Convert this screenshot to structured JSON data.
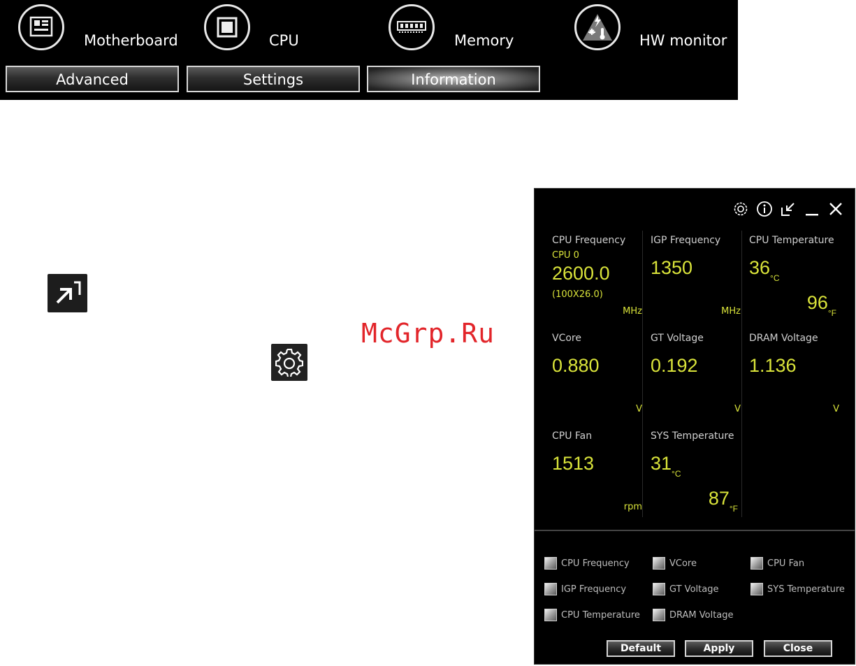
{
  "topbar": {
    "tabs": [
      {
        "label": "Motherboard",
        "icon": "motherboard-icon"
      },
      {
        "label": "CPU",
        "icon": "cpu-icon"
      },
      {
        "label": "Memory",
        "icon": "memory-icon"
      },
      {
        "label": "HW monitor",
        "icon": "hw-monitor-icon"
      }
    ],
    "subtabs": [
      {
        "label": "Advanced",
        "active": false
      },
      {
        "label": "Settings",
        "active": false
      },
      {
        "label": "Information",
        "active": true
      }
    ]
  },
  "watermark": "McGrp.Ru",
  "monitor": {
    "titlebar_icons": [
      "settings-gear-icon",
      "info-icon",
      "shrink-icon",
      "minimize-icon",
      "close-icon"
    ],
    "tiles": {
      "cpu_freq": {
        "label": "CPU Frequency",
        "sub_top": "CPU 0",
        "value": "2600.0",
        "sub_bottom": "(100X26.0)",
        "unit": "MHz"
      },
      "igp_freq": {
        "label": "IGP Frequency",
        "value": "1350",
        "unit": "MHz"
      },
      "cpu_temp": {
        "label": "CPU Temperature",
        "value_c": "36",
        "unit_c": "°C",
        "value_f": "96",
        "unit_f": "°F"
      },
      "vcore": {
        "label": "VCore",
        "value": "0.880",
        "unit": "V"
      },
      "gt_voltage": {
        "label": "GT Voltage",
        "value": "0.192",
        "unit": "V"
      },
      "dram_voltage": {
        "label": "DRAM Voltage",
        "value": "1.136",
        "unit": "V"
      },
      "cpu_fan": {
        "label": "CPU Fan",
        "value": "1513",
        "unit": "rpm"
      },
      "sys_temp": {
        "label": "SYS Temperature",
        "value_c": "31",
        "unit_c": "°C",
        "value_f": "87",
        "unit_f": "°F"
      }
    },
    "checkboxes": [
      {
        "label": "CPU Frequency"
      },
      {
        "label": "IGP Frequency"
      },
      {
        "label": "CPU Temperature"
      },
      {
        "label": "VCore"
      },
      {
        "label": "GT Voltage"
      },
      {
        "label": "DRAM Voltage"
      },
      {
        "label": "CPU Fan"
      },
      {
        "label": "SYS Temperature"
      }
    ],
    "buttons": {
      "default": "Default",
      "apply": "Apply",
      "close": "Close"
    }
  },
  "colors": {
    "value": "#d9e33a",
    "panel_bg": "#000000",
    "label": "#cfcfcf"
  }
}
